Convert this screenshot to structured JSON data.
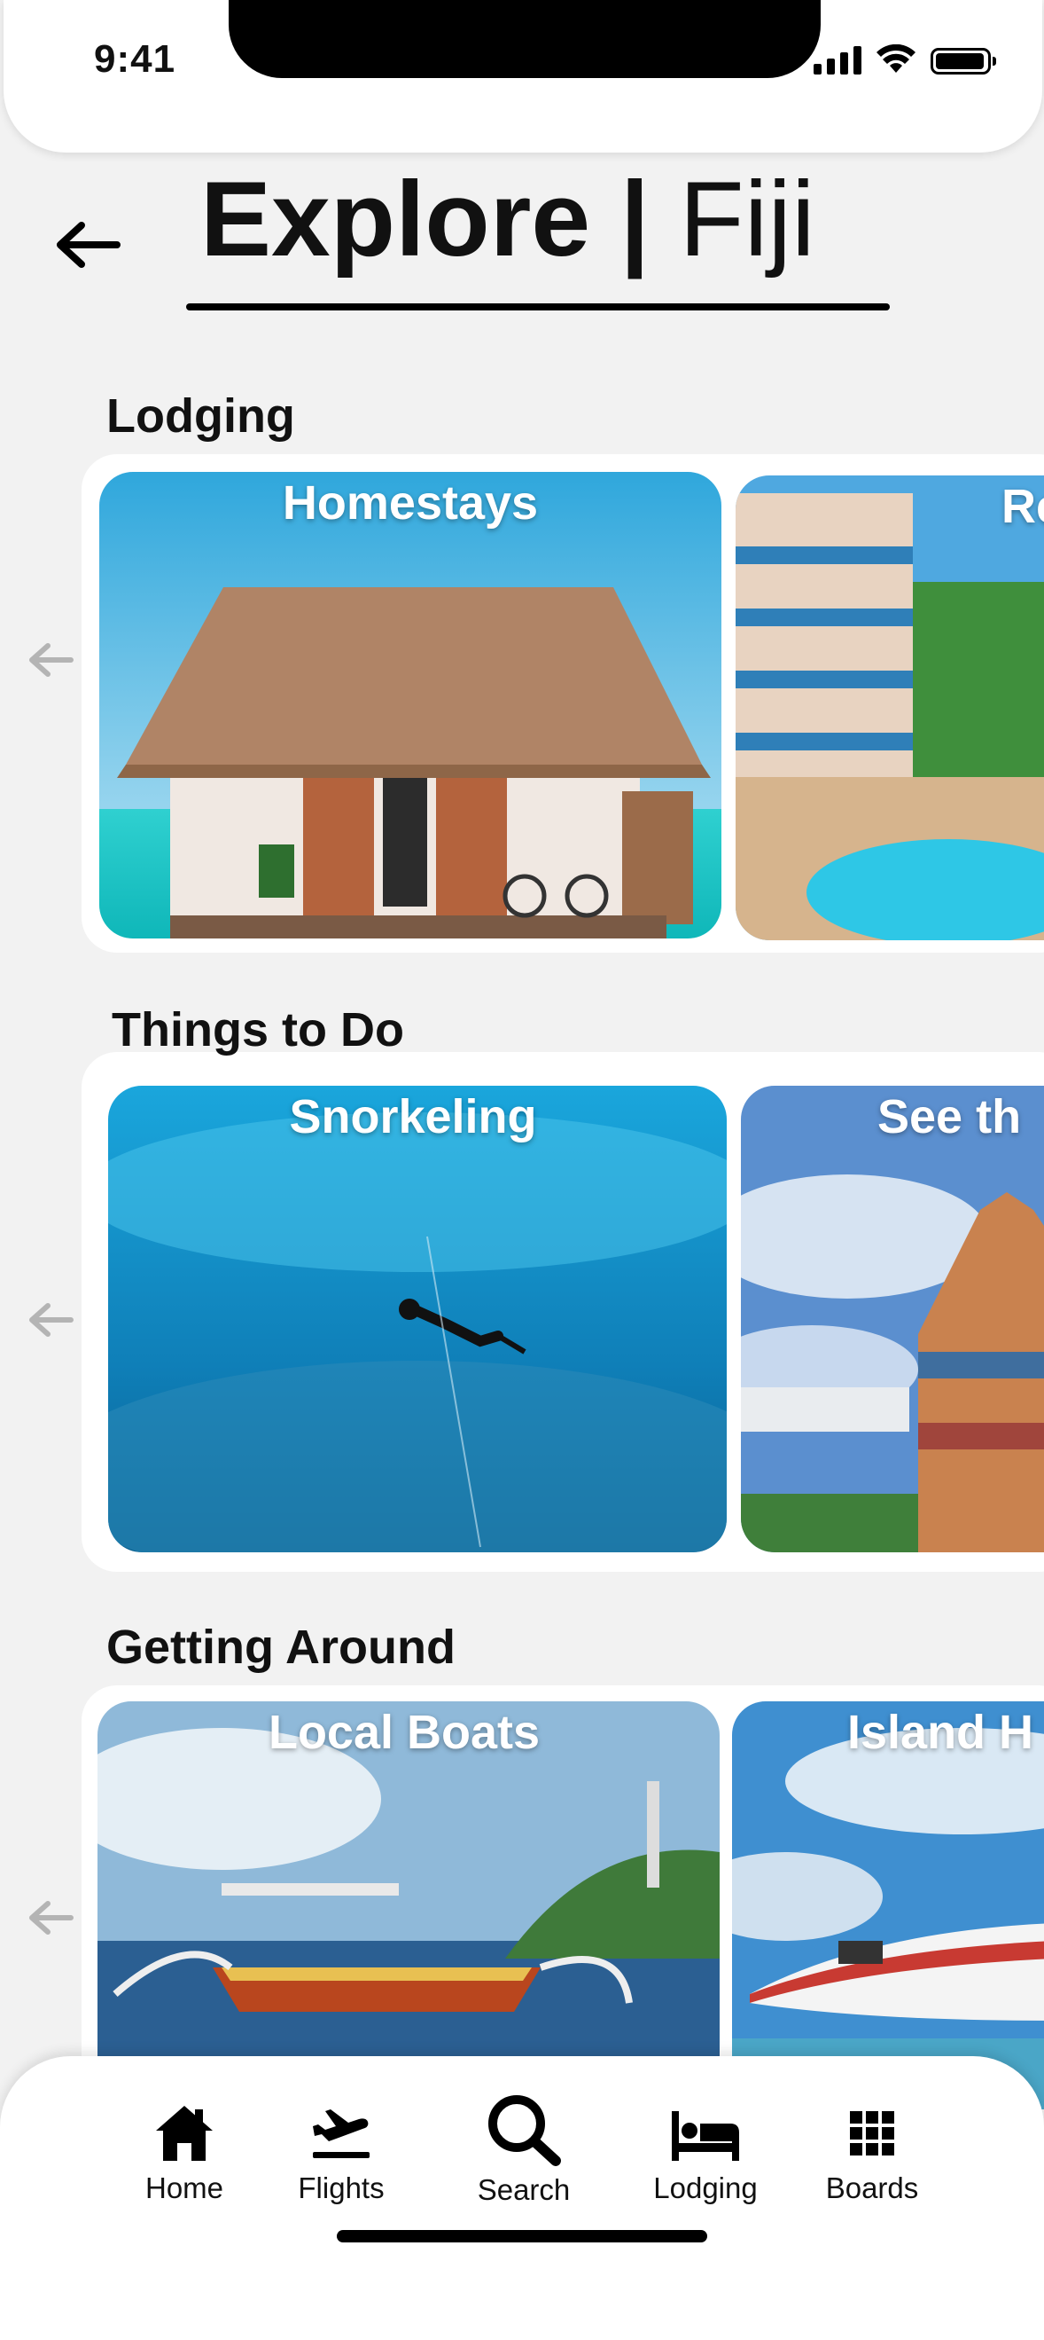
{
  "status_bar": {
    "time": "9:41"
  },
  "header": {
    "title_bold": "Explore",
    "separator": "|",
    "title_light": "Fiji"
  },
  "sections": [
    {
      "title": "Lodging",
      "cards": [
        "Homestays",
        "Re"
      ]
    },
    {
      "title": "Things to Do",
      "cards": [
        "Snorkeling",
        "See th"
      ]
    },
    {
      "title": "Getting Around",
      "cards": [
        "Local Boats",
        "Island H"
      ]
    }
  ],
  "nav": [
    {
      "label": "Home",
      "icon": "home-icon"
    },
    {
      "label": "Flights",
      "icon": "plane-departure-icon"
    },
    {
      "label": "Search",
      "icon": "search-icon"
    },
    {
      "label": "Lodging",
      "icon": "bed-icon"
    },
    {
      "label": "Boards",
      "icon": "grid-icon"
    }
  ],
  "colors": {
    "background": "#f2f2f2",
    "surface": "#ffffff",
    "text": "#111111"
  }
}
